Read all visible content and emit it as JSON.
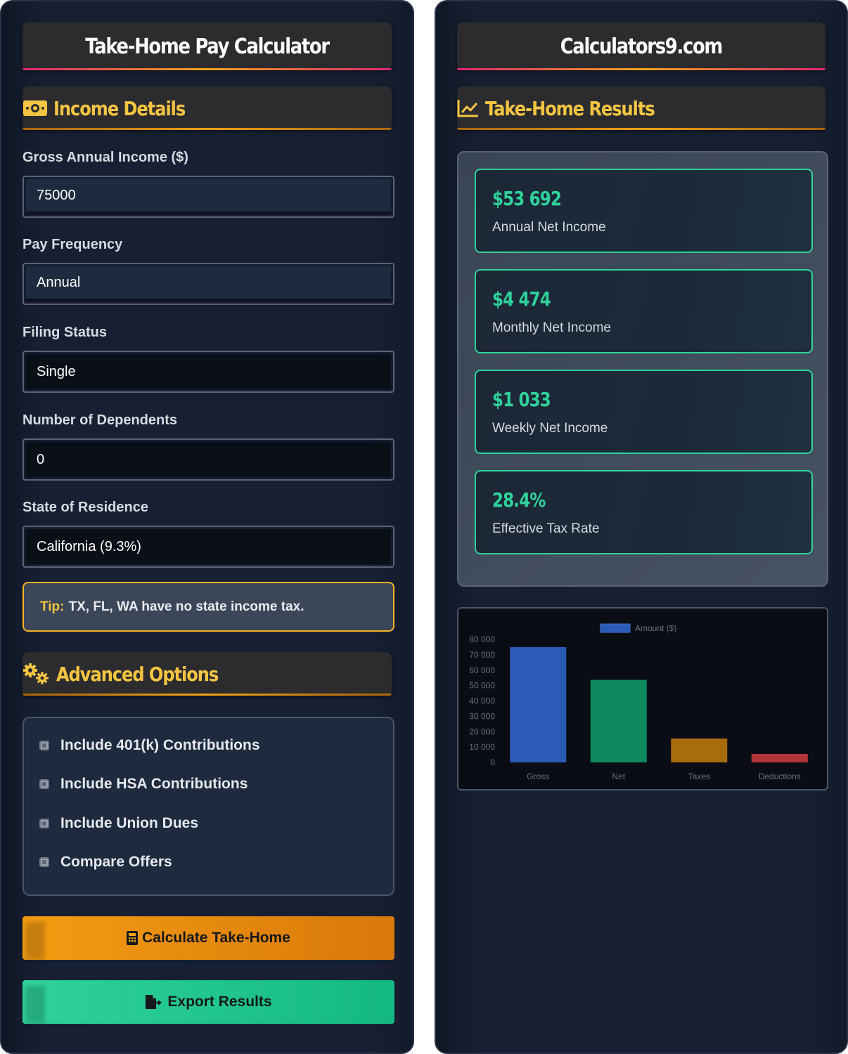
{
  "left": {
    "title": "Take-Home Pay Calculator",
    "section_income": "Income Details",
    "fields": [
      {
        "label": "Gross Annual Income ($)",
        "value": "75000"
      },
      {
        "label": "Pay Frequency",
        "value": "Annual"
      },
      {
        "label": "Filing Status",
        "value": "Single"
      },
      {
        "label": "Number of Dependents",
        "value": "0"
      },
      {
        "label": "State of Residence",
        "value": "California (9.3%)"
      }
    ],
    "tip": {
      "key": "Tip:",
      "text": "TX, FL, WA have no state income tax."
    },
    "section_advanced": "Advanced Options",
    "options": [
      "Include 401(k) Contributions",
      "Include HSA Contributions",
      "Include Union Dues",
      "Compare Offers"
    ],
    "calculate_label": "Calculate Take-Home",
    "export_label": "Export Results"
  },
  "right": {
    "title": "Calculators9.com",
    "section_results": "Take-Home Results",
    "cards": [
      {
        "value": "$53 692",
        "caption": "Annual Net Income"
      },
      {
        "value": "$4 474",
        "caption": "Monthly Net Income"
      },
      {
        "value": "$1 033",
        "caption": "Weekly Net Income"
      },
      {
        "value": "28.4%",
        "caption": "Effective Tax Rate"
      }
    ]
  },
  "colors": {
    "accent_gold": "#f4c542",
    "accent_green": "#2fd39a",
    "orange_button": "#f39c12",
    "bar_gross": "#2b5bb7",
    "bar_net": "#0f8a5f",
    "bar_taxes": "#a86c0c",
    "bar_deductions": "#b3343a"
  },
  "chart_data": {
    "type": "bar",
    "categories": [
      "Gross",
      "Net",
      "Taxes",
      "Deductions"
    ],
    "series": [
      {
        "name": "Amount ($)",
        "values": [
          75000,
          53692,
          15500,
          5500
        ]
      }
    ],
    "yticks": [
      "0",
      "10 000",
      "20 000",
      "30 000",
      "40 000",
      "50 000",
      "60 000",
      "70 000",
      "80 000"
    ],
    "ylim": [
      0,
      80000
    ],
    "legend_position": "top"
  }
}
